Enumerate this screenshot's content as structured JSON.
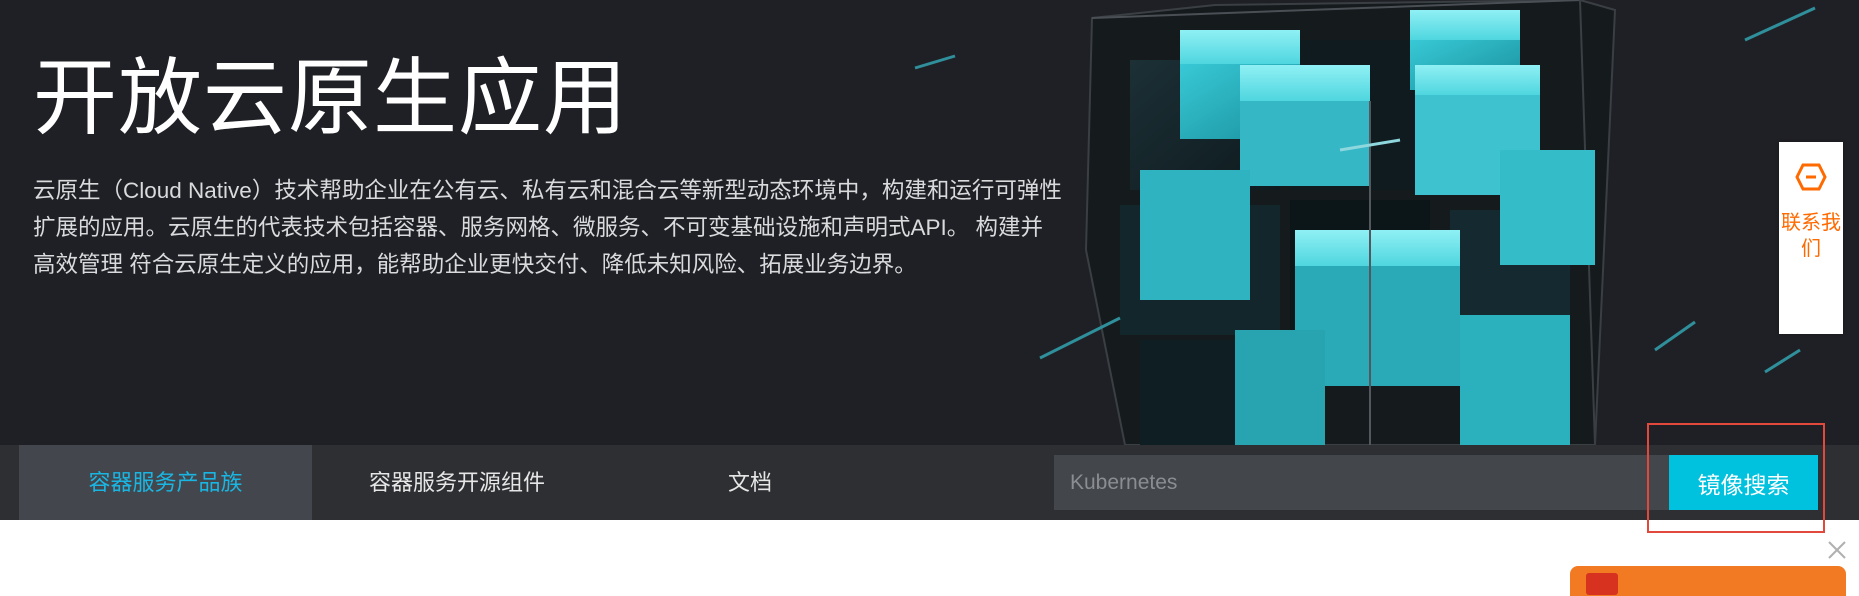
{
  "hero": {
    "title": "开放云原生应用",
    "description": "云原生（Cloud Native）技术帮助企业在公有云、私有云和混合云等新型动态环境中，构建和运行可弹性扩展的应用。云原生的代表技术包括容器、服务网格、微服务、不可变基础设施和声明式API。 构建并高效管理 符合云原生定义的应用，能帮助企业更快交付、降低未知风险、拓展业务边界。"
  },
  "nav": {
    "tabs": [
      {
        "label": "容器服务产品族",
        "active": true
      },
      {
        "label": "容器服务开源组件",
        "active": false
      },
      {
        "label": "文档",
        "active": false
      }
    ]
  },
  "search": {
    "placeholder": "Kubernetes",
    "value": "",
    "button_label": "镜像搜索"
  },
  "contact": {
    "label": "联系我们"
  },
  "colors": {
    "hero_background": "#1f2025",
    "nav_background": "#2d2f33",
    "active_tab_text": "#1ab6e3",
    "search_button": "#00c1de",
    "contact_accent": "#ff6a00",
    "highlight_border": "#e3483c"
  },
  "icons": {
    "contact": "hexagon-chat-icon",
    "close": "close-icon"
  }
}
